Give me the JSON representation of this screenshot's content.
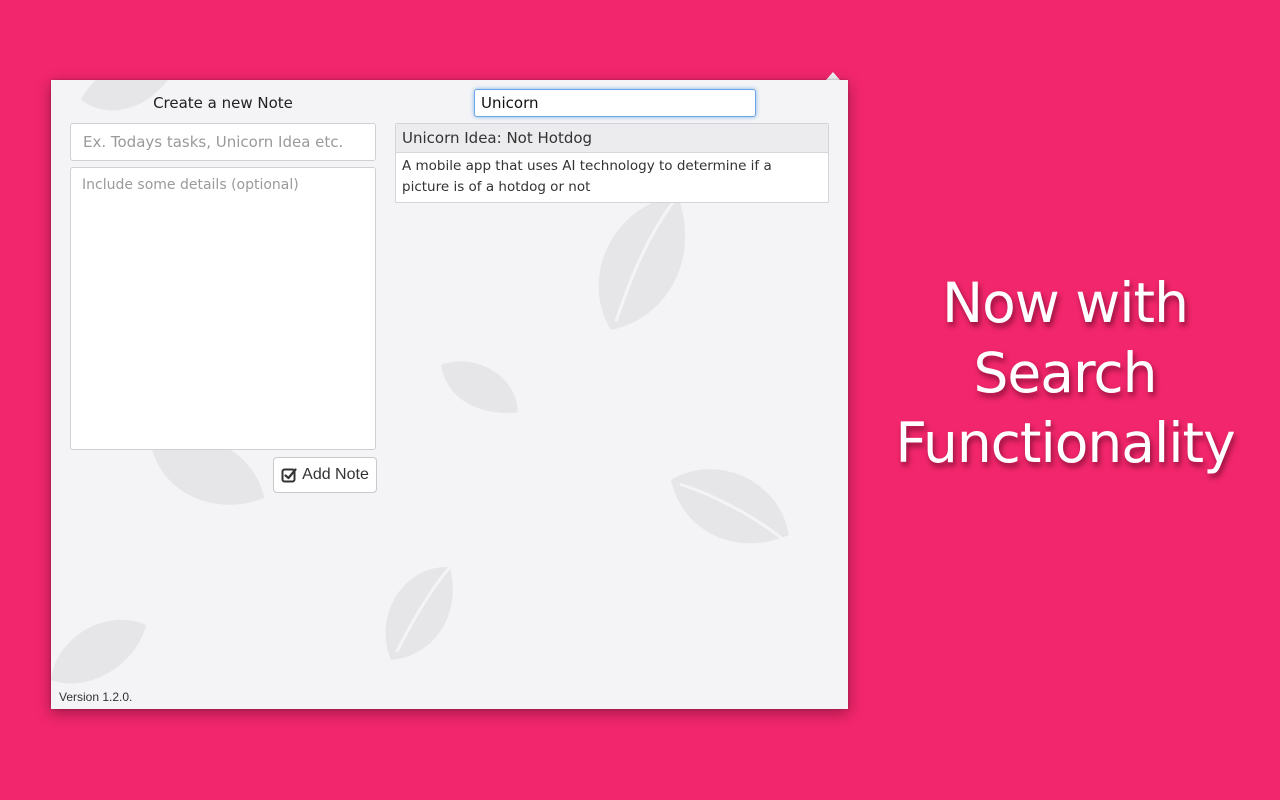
{
  "popup": {
    "create_title": "Create a new Note",
    "title_placeholder": "Ex. Todays tasks, Unicorn Idea etc.",
    "details_placeholder": "Include some details (optional)",
    "add_button_label": "Add Note",
    "add_button_icon": "checkbox-icon",
    "search_value": "Unicorn",
    "results": [
      {
        "title": "Unicorn Idea: Not Hotdog",
        "body": "A mobile app that uses AI technology to determine if a picture is of a hotdog or not"
      }
    ],
    "version": "Version 1.2.0."
  },
  "tagline": {
    "lines": [
      "Now with",
      "Search",
      "Functionality"
    ]
  },
  "colors": {
    "background": "#f2266c",
    "panel": "#f4f4f6",
    "leaf": "#e6e6e8",
    "search_focus": "#6aa6e8"
  }
}
